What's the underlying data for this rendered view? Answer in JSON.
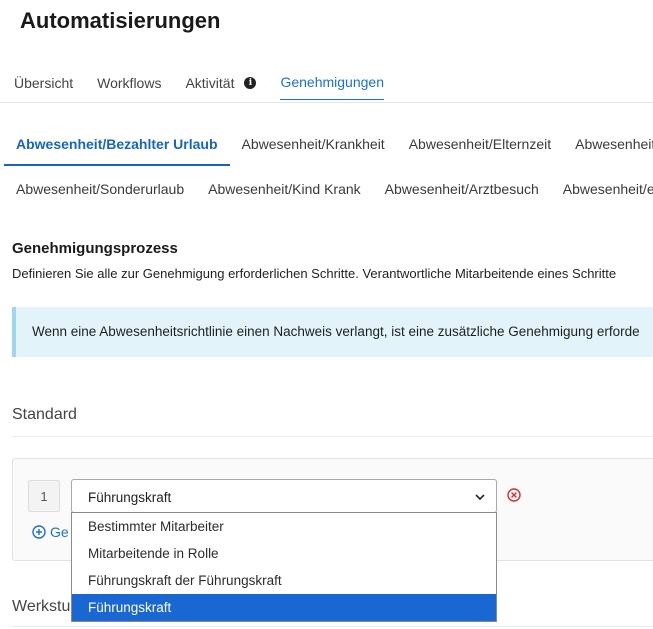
{
  "page": {
    "title": "Automatisierungen"
  },
  "tabs": [
    {
      "label": "Übersicht"
    },
    {
      "label": "Workflows"
    },
    {
      "label": "Aktivität"
    },
    {
      "label": "Genehmigungen"
    }
  ],
  "policy_tabs_row1": [
    {
      "label": "Abwesenheit/Bezahlter Urlaub"
    },
    {
      "label": "Abwesenheit/Krankheit"
    },
    {
      "label": "Abwesenheit/Elternzeit"
    },
    {
      "label": "Abwesenheit"
    }
  ],
  "policy_tabs_row2": [
    {
      "label": "Abwesenheit/Sonderurlaub"
    },
    {
      "label": "Abwesenheit/Kind Krank"
    },
    {
      "label": "Abwesenheit/Arztbesuch"
    },
    {
      "label": "Abwesenheit/e"
    }
  ],
  "process": {
    "heading": "Genehmigungsprozess",
    "description": "Definieren Sie alle zur Genehmigung erforderlichen Schritte. Verantwortliche Mitarbeitende eines Schritte",
    "info": "Wenn eine Abwesenheitsrichtlinie einen Nachweis verlangt, ist eine zusätzliche Genehmigung erforde"
  },
  "standard": {
    "label": "Standard",
    "step_number": "1",
    "selected_value": "Führungskraft",
    "add_step_label": "Ge",
    "options": [
      "Bestimmter Mitarbeiter",
      "Mitarbeitende in Rolle",
      "Führungskraft der Führungskraft",
      "Führungskraft"
    ]
  },
  "second_group": {
    "label": "Werkstu"
  },
  "colors": {
    "accent": "#1a73c8",
    "selected_option": "#1967d2",
    "info_bg": "#e3f3fa",
    "remove": "#d32f2f"
  }
}
